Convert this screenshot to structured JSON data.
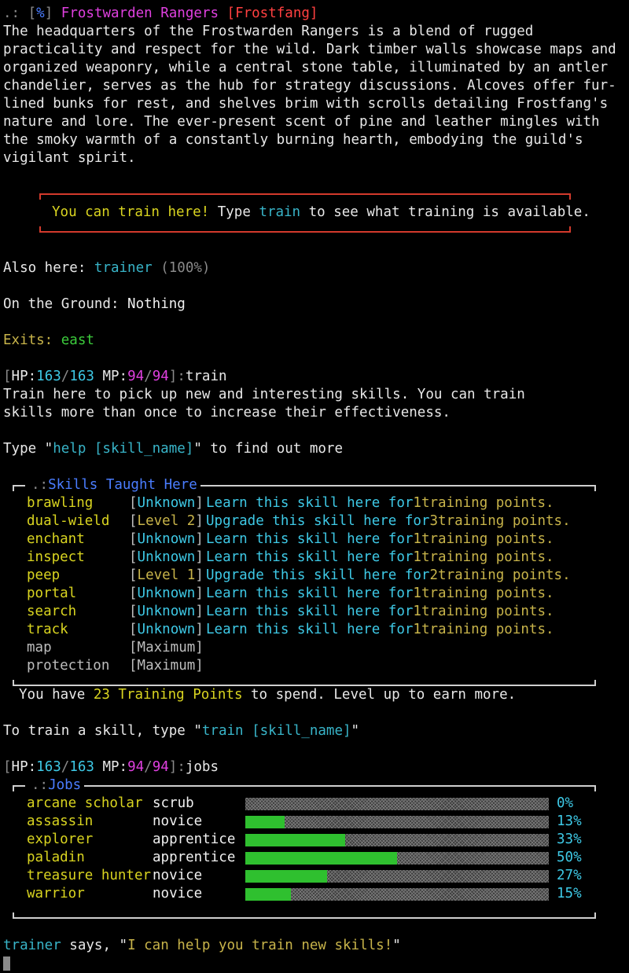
{
  "room": {
    "prefix": ".: ",
    "flag_open": "[",
    "flag": "%",
    "flag_close": "]",
    "name": "Frostwarden Rangers",
    "zone": "[Frostfang]",
    "description": "The headquarters of the Frostwarden Rangers is a blend of rugged practicality and respect for the wild. Dark timber walls showcase maps and organized weaponry, while a central stone table, illuminated by an antler chandelier, serves as the hub for strategy discussions. Alcoves offer fur-lined bunks for rest, and shelves brim with scrolls detailing Frostfang's nature and lore. The ever-present scent of pine and leather mingles with the smoky warmth of a constantly burning hearth, embodying the guild's vigilant spirit."
  },
  "notice": {
    "highlight": "You can train here!",
    "pre": " Type ",
    "command": "train",
    "post": " to see what training is available."
  },
  "also_here": {
    "label": "Also here: ",
    "npc": "trainer",
    "health": " (100%)"
  },
  "ground": {
    "label": "On the Ground: ",
    "value": "Nothing"
  },
  "exits": {
    "label": "Exits: ",
    "value": "east"
  },
  "prompt1": {
    "hp_label": "HP:",
    "hp": "163",
    "hp_max": "163",
    "mp_label": "MP:",
    "mp": "94",
    "mp_max": "94",
    "command": "train"
  },
  "train_intro": {
    "line1": "Train here to pick up new and interesting skills. You can train",
    "line2": "skills more than once to increase their effectiveness.",
    "help_pre": "Type \"",
    "help_cmd": "help [skill_name]",
    "help_post": "\" to find out more"
  },
  "skills_box": {
    "title": "Skills Taught Here",
    "skills": [
      {
        "name": "brawling",
        "level": "Unknown",
        "action": "Learn this skill here for",
        "cost": "1",
        "unit": "training points."
      },
      {
        "name": "dual-wield",
        "level": "Level 2",
        "action": "Upgrade this skill here for",
        "cost": "3",
        "unit": "training points."
      },
      {
        "name": "enchant",
        "level": "Unknown",
        "action": "Learn this skill here for",
        "cost": "1",
        "unit": "training points."
      },
      {
        "name": "inspect",
        "level": "Unknown",
        "action": "Learn this skill here for",
        "cost": "1",
        "unit": "training points."
      },
      {
        "name": "peep",
        "level": "Level 1",
        "action": "Upgrade this skill here for",
        "cost": "2",
        "unit": "training points."
      },
      {
        "name": "portal",
        "level": "Unknown",
        "action": "Learn this skill here for",
        "cost": "1",
        "unit": "training points."
      },
      {
        "name": "search",
        "level": "Unknown",
        "action": "Learn this skill here for",
        "cost": "1",
        "unit": "training points."
      },
      {
        "name": "track",
        "level": "Unknown",
        "action": "Learn this skill here for",
        "cost": "1",
        "unit": "training points."
      }
    ],
    "maxed": [
      {
        "name": "map",
        "level": "[Maximum]"
      },
      {
        "name": "protection",
        "level": "[Maximum]"
      }
    ],
    "points_pre": "You have ",
    "points": "23 Training Points",
    "points_post": " to spend. Level up to earn more."
  },
  "train_hint": {
    "pre": "To train a skill, type \"",
    "cmd": "train [skill_name]",
    "post": "\""
  },
  "prompt2": {
    "hp_label": "HP:",
    "hp": "163",
    "hp_max": "163",
    "mp_label": "MP:",
    "mp": "94",
    "mp_max": "94",
    "command": "jobs"
  },
  "jobs_box": {
    "title": "Jobs",
    "jobs": [
      {
        "name": "arcane scholar",
        "rank": "scrub",
        "percent": "0%",
        "progress": 0.0
      },
      {
        "name": "assassin",
        "rank": "novice",
        "percent": "13%",
        "progress": 0.13
      },
      {
        "name": "explorer",
        "rank": "apprentice",
        "percent": "33%",
        "progress": 0.33
      },
      {
        "name": "paladin",
        "rank": "apprentice",
        "percent": "50%",
        "progress": 0.5
      },
      {
        "name": "treasure hunter",
        "rank": "novice",
        "percent": "27%",
        "progress": 0.27
      },
      {
        "name": "warrior",
        "rank": "novice",
        "percent": "15%",
        "progress": 0.15
      }
    ]
  },
  "say": {
    "speaker": "trainer",
    "verb": " says, \"",
    "text": "I can help you train new skills!",
    "close": "\""
  },
  "colors": {
    "bar_fill": "#2fc02f",
    "notice_border": "#d33a2c",
    "room_name": "#e040e0"
  }
}
